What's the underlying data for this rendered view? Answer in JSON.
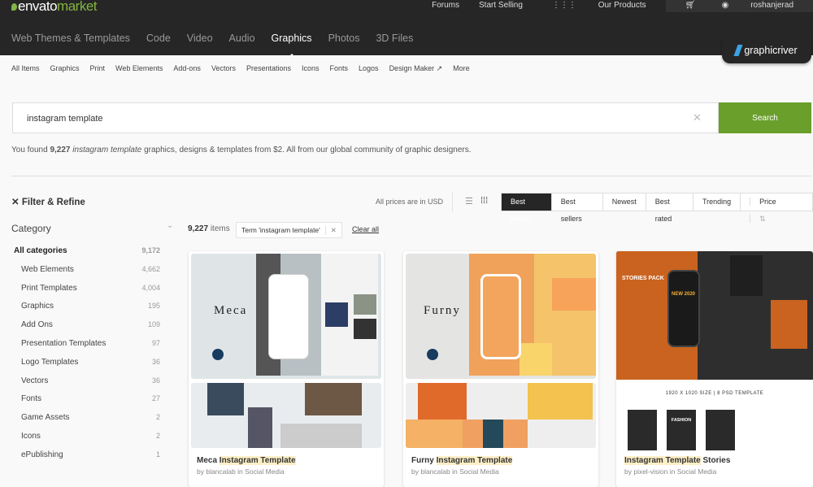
{
  "header": {
    "logo": "envatomarket",
    "logo_a": "envato",
    "logo_b": "market",
    "top_links": [
      "Forums",
      "Start Selling",
      "Our Products"
    ],
    "username": "roshanjerad",
    "nav": [
      "Web Themes & Templates",
      "Code",
      "Video",
      "Audio",
      "Graphics",
      "Photos",
      "3D Files"
    ],
    "active_nav": "Graphics",
    "site_badge": "graphicriver"
  },
  "subnav": [
    "All Items",
    "Graphics",
    "Print",
    "Web Elements",
    "Add-ons",
    "Vectors",
    "Presentations",
    "Icons",
    "Fonts",
    "Logos",
    "Design Maker",
    "More"
  ],
  "search": {
    "value": "instagram template",
    "button": "Search"
  },
  "found": {
    "pre": "You found ",
    "count": "9,227",
    "term": "instagram template",
    "post": " graphics, designs & templates from $2. All from our global community of graphic designers."
  },
  "filter": {
    "title": "Filter & Refine",
    "category_title": "Category",
    "categories": [
      {
        "label": "All categories",
        "count": "9,172"
      },
      {
        "label": "Web Elements",
        "count": "4,662"
      },
      {
        "label": "Print Templates",
        "count": "4,004"
      },
      {
        "label": "Graphics",
        "count": "195"
      },
      {
        "label": "Add Ons",
        "count": "109"
      },
      {
        "label": "Presentation Templates",
        "count": "97"
      },
      {
        "label": "Logo Templates",
        "count": "36"
      },
      {
        "label": "Vectors",
        "count": "36"
      },
      {
        "label": "Fonts",
        "count": "27"
      },
      {
        "label": "Game Assets",
        "count": "2"
      },
      {
        "label": "Icons",
        "count": "2"
      },
      {
        "label": "ePublishing",
        "count": "1"
      }
    ]
  },
  "results": {
    "currency_note": "All prices are in USD",
    "sorts": [
      "Best match",
      "Best sellers",
      "Newest",
      "Best rated",
      "Trending",
      "Price"
    ],
    "active_sort": "Best match",
    "count": "9,227",
    "count_label": "items",
    "term_chip": "Term 'instagram template'",
    "clear_all": "Clear all"
  },
  "cards": [
    {
      "name": "Meca",
      "title_pre": "Meca ",
      "title_hl": "Instagram Template",
      "title_post": "",
      "byline": "by blancalab in Social Media"
    },
    {
      "name": "Furny",
      "title_pre": "Furny ",
      "title_hl": "Instagram Template",
      "title_post": "",
      "byline": "by blancalab in Social Media"
    },
    {
      "name": "",
      "title_pre": "",
      "title_hl": "Instagram Template",
      "title_post": " Stories",
      "byline": "by pixel-vision in Social Media",
      "thumb_texts": [
        "STORIES PACK",
        "NEW 2020",
        "1920 X 1020 SIZE | 8 PSD TEMPLATE",
        "FASHION"
      ]
    }
  ],
  "colors": {
    "header": "#262626",
    "accent": "#82b541",
    "search_button": "#6a9f2c",
    "highlight": "#fdefc6"
  }
}
